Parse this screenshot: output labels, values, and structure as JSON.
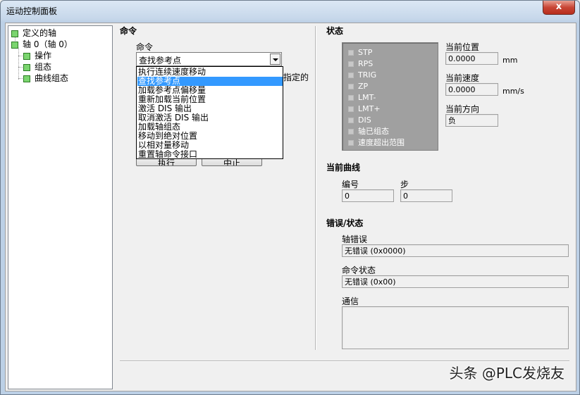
{
  "window": {
    "title": "运动控制面板",
    "close_label": "x"
  },
  "tree": {
    "items": [
      {
        "label": "定义的轴"
      },
      {
        "label": "轴 0（轴 0）"
      },
      {
        "label": "操作"
      },
      {
        "label": "组态"
      },
      {
        "label": "曲线组态"
      }
    ]
  },
  "command": {
    "section": "命令",
    "field_label": "命令",
    "selected": "查找参考点",
    "hidden_text_fragment": "指定的",
    "options": [
      "执行连续速度移动",
      "查找参考点",
      "加载参考点偏移量",
      "重新加载当前位置",
      "激活 DIS 输出",
      "取消激活 DIS 输出",
      "加载轴组态",
      "移动到绝对位置",
      "以相对量移动",
      "重置轴命令接口"
    ],
    "execute_label": "执行",
    "stop_label": "中止"
  },
  "status": {
    "section": "状态",
    "items": [
      "STP",
      "RPS",
      "TRIG",
      "ZP",
      "LMT-",
      "LMT+",
      "DIS",
      "轴已组态",
      "速度超出范围"
    ],
    "current_position_label": "当前位置",
    "current_position": "0.0000",
    "position_unit": "mm",
    "current_speed_label": "当前速度",
    "current_speed": "0.0000",
    "speed_unit": "mm/s",
    "current_direction_label": "当前方向",
    "current_direction": "负"
  },
  "curve": {
    "section": "当前曲线",
    "number_label": "编号",
    "number": "0",
    "step_label": "步",
    "step": "0"
  },
  "errors": {
    "section": "错误/状态",
    "axis_error_label": "轴错误",
    "axis_error": "无错误 (0x0000)",
    "command_status_label": "命令状态",
    "command_status": "无错误 (0x00)",
    "comm_label": "通信",
    "comm": ""
  },
  "watermark": "头条 @PLC发烧友"
}
